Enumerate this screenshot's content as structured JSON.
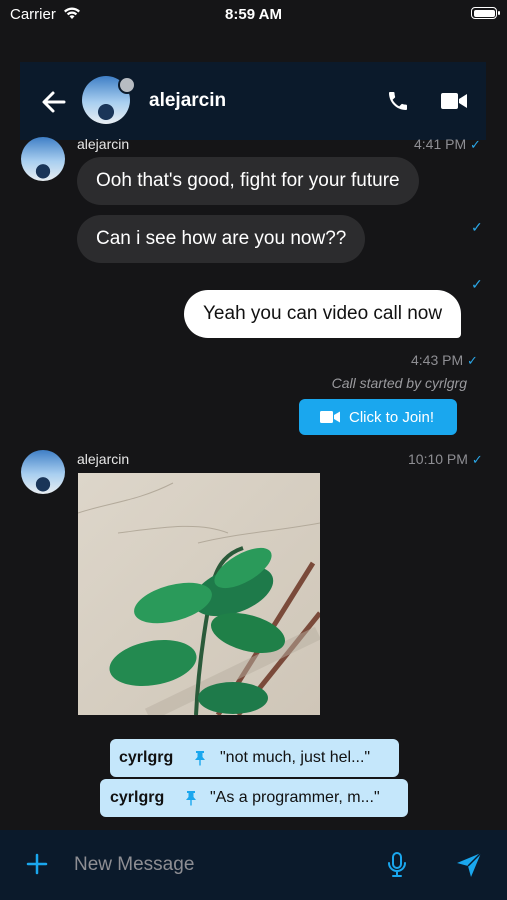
{
  "status_bar": {
    "carrier": "Carrier",
    "time": "8:59 AM"
  },
  "header": {
    "title": "alejarcin"
  },
  "messages": [
    {
      "sender": "alejarcin",
      "time": "4:41 PM",
      "texts": [
        "Ooh that's good, fight for your future",
        "Can i see how are you now??"
      ]
    },
    {
      "text": "Yeah you can video call now",
      "time": "4:43 PM"
    },
    {
      "call_text": "Call started by cyrlgrg",
      "join_label": "Click to Join!"
    },
    {
      "sender": "alejarcin",
      "time": "10:10 PM"
    }
  ],
  "pinned": [
    {
      "user": "cyrlgrg",
      "text": "\"not much, just hel...\""
    },
    {
      "user": "cyrlgrg",
      "text": "\"As a programmer, m...\""
    }
  ],
  "composer": {
    "placeholder": "New Message"
  },
  "colors": {
    "accent": "#1aa7ee",
    "header_bg": "#0b1a2b",
    "background": "#151517",
    "pin_bg": "#c5e7fb"
  },
  "icons": [
    "wifi-icon",
    "battery-icon",
    "back-arrow-icon",
    "phone-icon",
    "video-camera-icon",
    "pin-icon",
    "plus-icon",
    "microphone-icon",
    "send-icon"
  ]
}
